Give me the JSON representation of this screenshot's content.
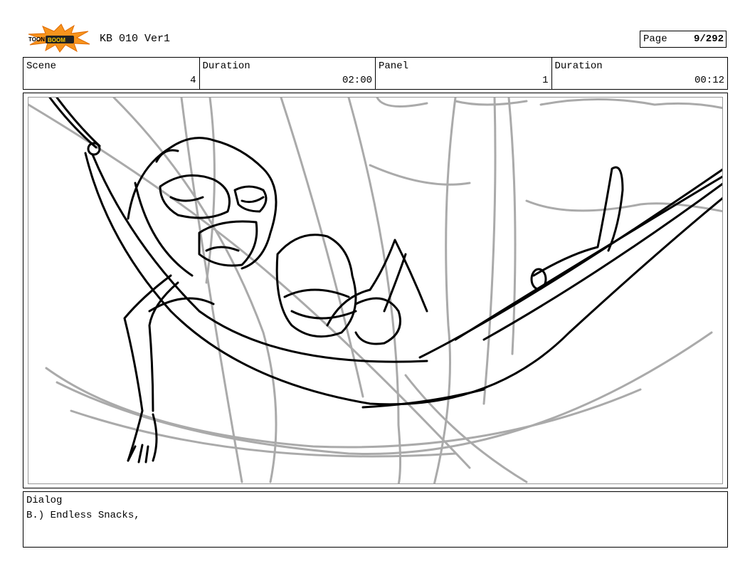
{
  "header": {
    "logo": "TOONBOOM",
    "project_title": "KB 010 Ver1",
    "page_label": "Page",
    "page_value": "9/292"
  },
  "info_bar": {
    "scene_label": "Scene",
    "scene_value": "4",
    "scene_duration_label": "Duration",
    "scene_duration_value": "02:00",
    "panel_label": "Panel",
    "panel_value": "1",
    "panel_duration_label": "Duration",
    "panel_duration_value": "00:12"
  },
  "dialog": {
    "label": "Dialog",
    "text": "B.) Endless Snacks,"
  }
}
